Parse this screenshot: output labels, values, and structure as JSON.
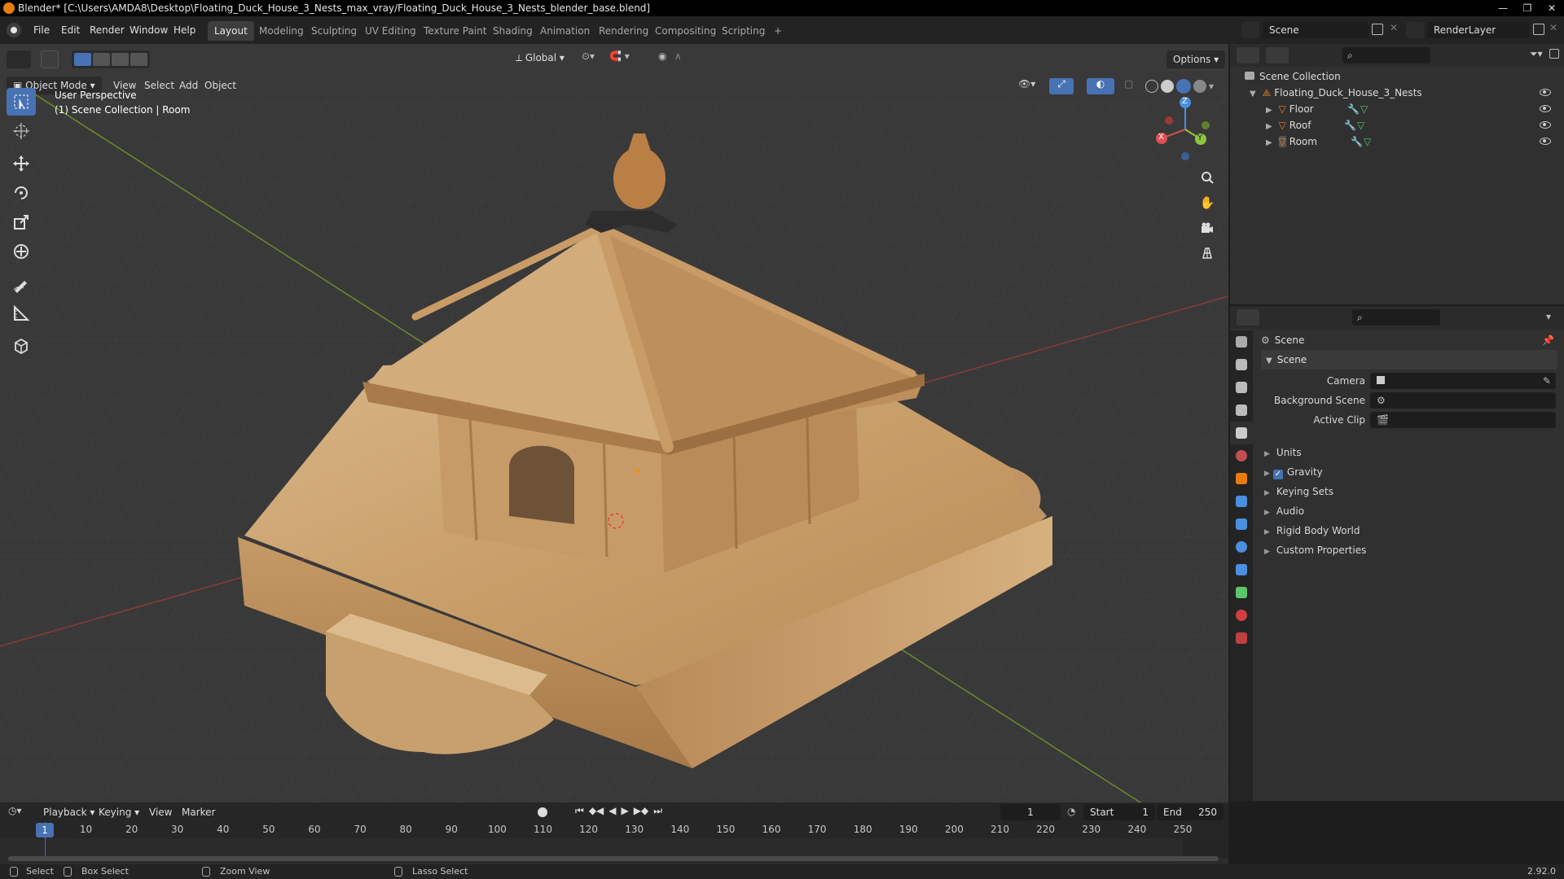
{
  "window": {
    "title": "Blender* [C:\\Users\\AMDA8\\Desktop\\Floating_Duck_House_3_Nests_max_vray/Floating_Duck_House_3_Nests_blender_base.blend]"
  },
  "menu": [
    "File",
    "Edit",
    "Render",
    "Window",
    "Help"
  ],
  "workspaces": [
    "Layout",
    "Modeling",
    "Sculpting",
    "UV Editing",
    "Texture Paint",
    "Shading",
    "Animation",
    "Rendering",
    "Compositing",
    "Scripting"
  ],
  "workspace_active": "Layout",
  "workspace_add": "+",
  "scene_field": "Scene",
  "renderlayer_field": "RenderLayer",
  "viewport": {
    "mode": "Object Mode",
    "menus": [
      "View",
      "Select",
      "Add",
      "Object"
    ],
    "transform_orientation": "Global",
    "options_label": "Options",
    "overlay_line1": "User Perspective",
    "overlay_line2": "(1) Scene Collection | Room",
    "gizmo": {
      "x": "X",
      "y": "Y",
      "z": "Z"
    }
  },
  "outliner": {
    "root": "Scene Collection",
    "collection": "Floating_Duck_House_3_Nests",
    "objects": [
      "Floor",
      "Roof",
      "Room"
    ]
  },
  "properties": {
    "header": "Scene",
    "panel_title": "Scene",
    "fields": [
      {
        "label": "Camera",
        "value": ""
      },
      {
        "label": "Background Scene",
        "value": ""
      },
      {
        "label": "Active Clip",
        "value": ""
      }
    ],
    "panels": [
      "Units",
      "Gravity",
      "Keying Sets",
      "Audio",
      "Rigid Body World",
      "Custom Properties"
    ],
    "gravity_checked": true
  },
  "timeline": {
    "menus": [
      "Playback",
      "Keying",
      "View",
      "Marker"
    ],
    "current_frame": "1",
    "start_label": "Start",
    "start": "1",
    "end_label": "End",
    "end": "250",
    "playhead_label": "1",
    "ticks": [
      "10",
      "20",
      "30",
      "40",
      "50",
      "60",
      "70",
      "80",
      "90",
      "100",
      "110",
      "120",
      "130",
      "140",
      "150",
      "160",
      "170",
      "180",
      "190",
      "200",
      "210",
      "220",
      "230",
      "240",
      "250"
    ]
  },
  "statusbar": {
    "items": [
      "Select",
      "Box Select",
      "Zoom View",
      "Lasso Select"
    ],
    "version": "2.92.0"
  },
  "colors": {
    "accent": "#4772b3",
    "x_axis": "#e05050",
    "y_axis": "#8cc63e",
    "z_axis": "#4a8fe0",
    "wood": "#c9a26f"
  }
}
